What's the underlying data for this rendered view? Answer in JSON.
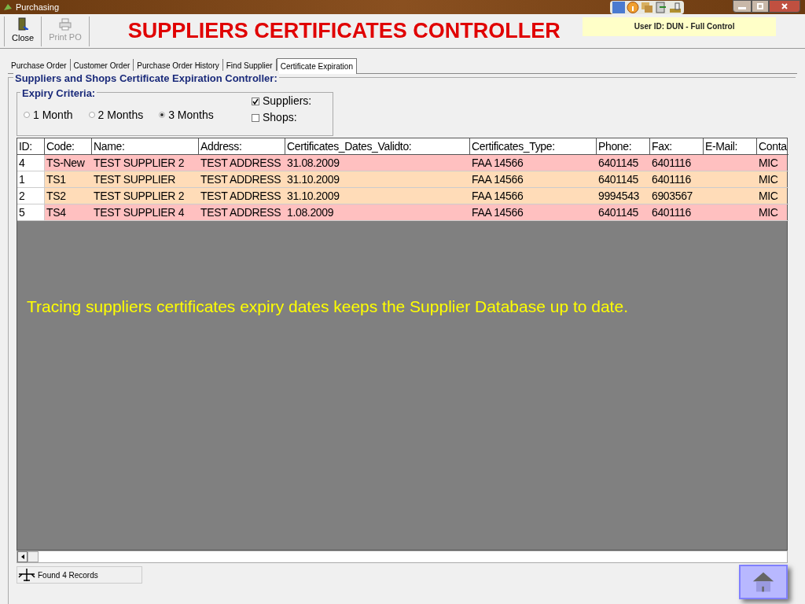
{
  "window": {
    "title": "Purchasing"
  },
  "toolbar": [
    {
      "label": "Close",
      "disabled": false
    },
    {
      "label": "Print PO",
      "disabled": true
    }
  ],
  "heading": "SUPPLIERS CERTIFICATES CONTROLLER",
  "user_info": "User ID: DUN - Full Control",
  "tabs": [
    {
      "label": "Purchase Order",
      "selected": false
    },
    {
      "label": "Customer Order",
      "selected": false
    },
    {
      "label": "Purchase Order History",
      "selected": false
    },
    {
      "label": "Find Supplier",
      "selected": false
    },
    {
      "label": "Certificate Expiration",
      "selected": true
    }
  ],
  "group_title": "Suppliers and Shops Certificate Expiration Controller:",
  "criteria": {
    "title": "Expiry Criteria:",
    "periods": [
      {
        "label": "1 Month",
        "selected": false
      },
      {
        "label": "2 Months",
        "selected": false
      },
      {
        "label": "3 Months",
        "selected": true
      }
    ],
    "filters": [
      {
        "label": "Suppliers:",
        "checked": true
      },
      {
        "label": "Shops:",
        "checked": false
      }
    ]
  },
  "table": {
    "columns": [
      "ID:",
      "Code:",
      "Name:",
      "Address:",
      "Certificates_Dates_Validto:",
      "Certificates_Type:",
      "Phone:",
      "Fax:",
      "E-Mail:",
      "Conta"
    ],
    "rows": [
      {
        "color": "#ffc0c0",
        "cells": [
          "4",
          "TS-New",
          "TEST SUPPLIER 2",
          "TEST ADDRESS",
          "31.08.2009",
          "FAA 14566",
          "6401145",
          "6401116",
          "",
          "MIC"
        ]
      },
      {
        "color": "#ffdcb8",
        "cells": [
          "1",
          "TS1",
          "TEST SUPPLIER",
          "TEST ADDRESS",
          "31.10.2009",
          "FAA 14566",
          "6401145",
          "6401116",
          "",
          "MIC"
        ]
      },
      {
        "color": "#ffdcb8",
        "cells": [
          "2",
          "TS2",
          "TEST SUPPLIER 2",
          "TEST ADDRESS",
          "31.10.2009",
          "FAA 14566",
          "9994543",
          "6903567",
          "",
          "MIC"
        ]
      },
      {
        "color": "#ffc0c0",
        "cells": [
          "5",
          "TS4",
          "TEST SUPPLIER 4",
          "TEST ADDRESS",
          "1.08.2009",
          "FAA 14566",
          "6401145",
          "6401116",
          "",
          "MIC"
        ]
      }
    ]
  },
  "caption": "Tracing suppliers certificates expiry dates keeps the Supplier Database up to date.",
  "status_bar": "Found 4 Records"
}
